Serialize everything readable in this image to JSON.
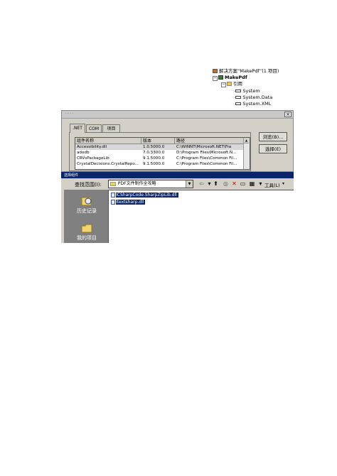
{
  "solution_explorer": {
    "solution": "解决方案“MakePdf”(1 项目)",
    "project": "MakePdf",
    "references_folder": "引用",
    "references": [
      "System",
      "System.Data",
      "System.XML"
    ]
  },
  "add_reference": {
    "tabs": [
      ".NET",
      "COM",
      "项目"
    ],
    "columns": [
      "组件名称",
      "版本",
      "路径"
    ],
    "rows": [
      {
        "name": "Accessibility.dll",
        "version": "1.0.5000.0",
        "path": "C:\\WINNT\\Microsoft.NET\\Fra"
      },
      {
        "name": "adodb",
        "version": "7.0.3300.0",
        "path": "D:\\Program Files\\Microsoft.N..."
      },
      {
        "name": "CRVsPackageLib",
        "version": "9.1.5000.0",
        "path": "C:\\Program Files\\Common Fil..."
      },
      {
        "name": "CrystalDecisions.CrystalRepo...",
        "version": "9.1.5000.0",
        "path": "C:\\Program Files\\Common Fil..."
      }
    ],
    "browse_button": "浏览(B)...",
    "select_button": "选择(E)",
    "close_glyph": "×"
  },
  "choose_component": {
    "title": "选择组件",
    "look_in_label": "查找范围(I):",
    "look_in_value": "PDF文件制作全攻略",
    "tools_label": "工具(L)",
    "places": [
      "历史记录",
      "我的项目"
    ],
    "files": [
      "ICSharpCode.SharpZipLib.dll",
      "itextsharp.dll"
    ]
  }
}
